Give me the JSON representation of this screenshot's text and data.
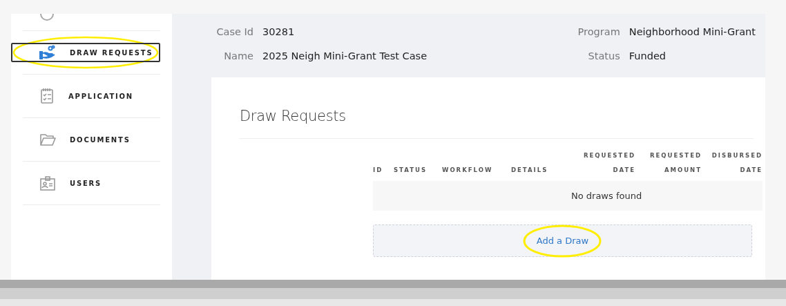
{
  "sidebar": {
    "items": [
      {
        "label": "DRAW REQUESTS",
        "selected": true,
        "highlighted": true
      },
      {
        "label": "APPLICATION",
        "selected": false,
        "highlighted": false
      },
      {
        "label": "DOCUMENTS",
        "selected": false,
        "highlighted": false
      },
      {
        "label": "USERS",
        "selected": false,
        "highlighted": false
      }
    ]
  },
  "case_info": {
    "left": [
      {
        "label": "Case Id",
        "value": "30281"
      },
      {
        "label": "Name",
        "value": "2025 Neigh Mini-Grant Test Case"
      }
    ],
    "right": [
      {
        "label": "Program",
        "value": "Neighborhood Mini-Grant"
      },
      {
        "label": "Status",
        "value": "Funded"
      }
    ]
  },
  "card": {
    "title": "Draw Requests",
    "table": {
      "columns": [
        {
          "label": "ID",
          "kind": "text"
        },
        {
          "label": "STATUS",
          "kind": "text"
        },
        {
          "label": "WORKFLOW",
          "kind": "text"
        },
        {
          "label": "DETAILS",
          "kind": "text"
        },
        {
          "label": "REQUESTED DATE",
          "kind": "date"
        },
        {
          "label": "REQUESTED AMOUNT",
          "kind": "amount"
        },
        {
          "label": "DISBURSED DATE",
          "kind": "date"
        }
      ],
      "empty_message": "No draws found"
    },
    "add_button": {
      "label": "Add a Draw",
      "highlighted": true
    }
  }
}
